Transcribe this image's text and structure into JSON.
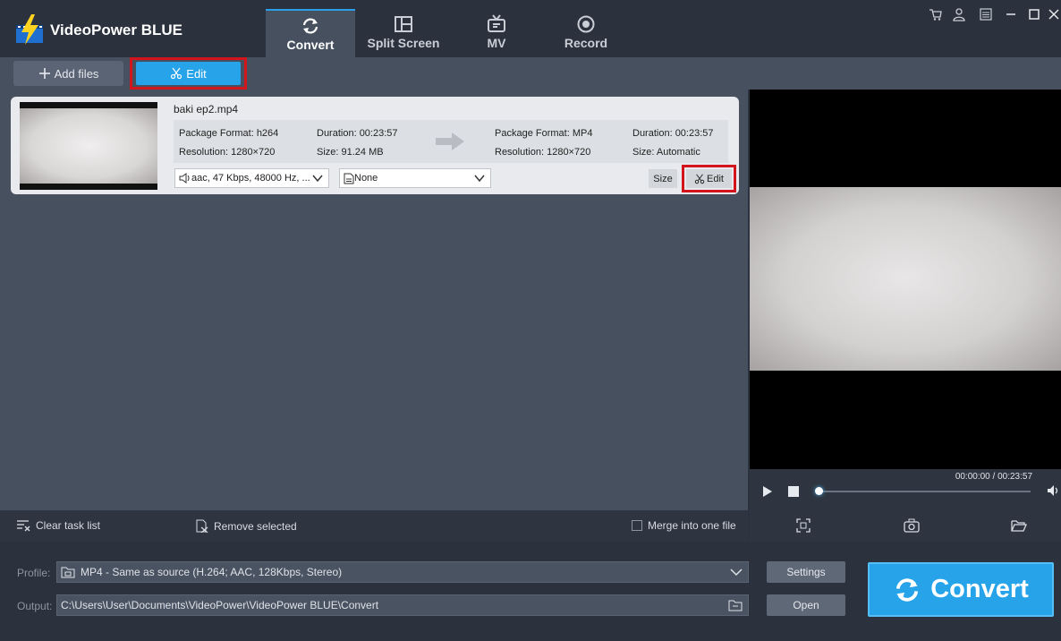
{
  "app": {
    "title": "VideoPower BLUE"
  },
  "tabs": [
    {
      "label": "Convert",
      "icon": "refresh-icon",
      "active": true
    },
    {
      "label": "Split Screen",
      "icon": "split-screen-icon"
    },
    {
      "label": "MV",
      "icon": "tv-icon"
    },
    {
      "label": "Record",
      "icon": "record-icon"
    }
  ],
  "toolbar": {
    "add_files": "Add files",
    "edit": "Edit"
  },
  "task": {
    "file_name": "baki ep2.mp4",
    "source": {
      "package_format": "Package Format: h264",
      "duration": "Duration: 00:23:57",
      "resolution": "Resolution: 1280×720",
      "size": "Size: 91.24 MB"
    },
    "target": {
      "package_format": "Package Format: MP4",
      "duration": "Duration: 00:23:57",
      "resolution": "Resolution: 1280×720",
      "size": "Size: Automatic"
    },
    "audio_track": "aac, 47 Kbps, 48000 Hz, ...",
    "subtitle": "None",
    "size_button": "Size",
    "edit_button": "Edit"
  },
  "player": {
    "time": "00:00:00 / 00:23:57",
    "progress": 0.0
  },
  "actions": {
    "clear_task_list": "Clear task list",
    "remove_selected": "Remove selected",
    "merge": "Merge into one file"
  },
  "settings": {
    "profile_label": "Profile:",
    "profile_value": "MP4 - Same as source (H.264; AAC, 128Kbps, Stereo)",
    "output_label": "Output:",
    "output_value": "C:\\Users\\User\\Documents\\VideoPower\\VideoPower BLUE\\Convert",
    "settings_button": "Settings",
    "open_button": "Open",
    "convert_button": "Convert"
  },
  "colors": {
    "accent": "#27a3ea",
    "highlight": "#d4141c"
  }
}
